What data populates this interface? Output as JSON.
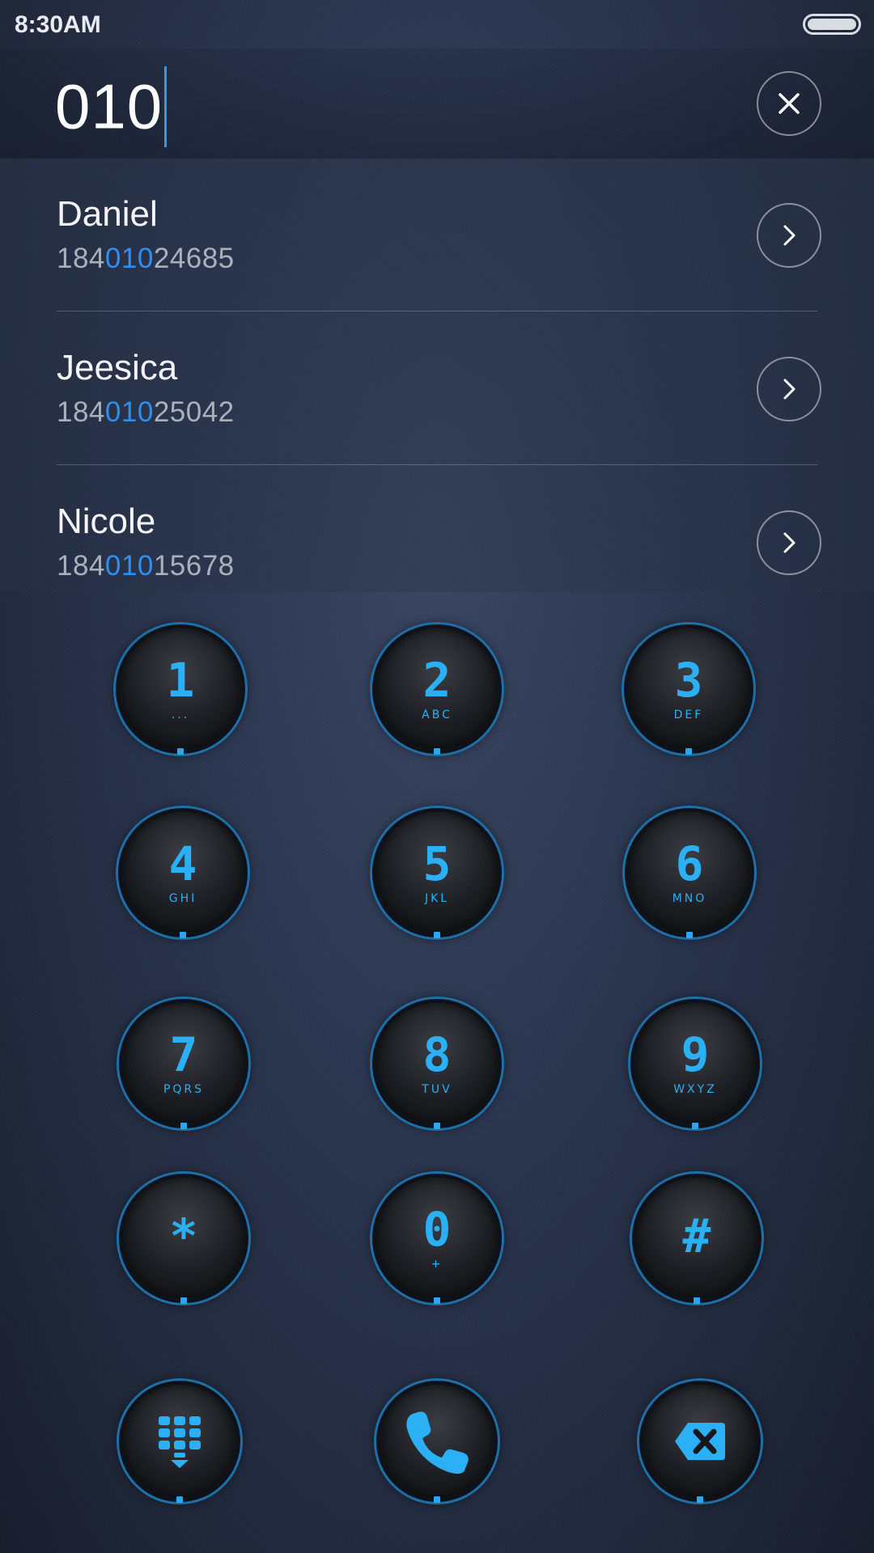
{
  "status_bar": {
    "time": "8:30AM"
  },
  "dialer": {
    "input_value": "010"
  },
  "contacts": [
    {
      "name": "Daniel",
      "number_prefix": "184",
      "number_match": "010",
      "number_suffix": "24685"
    },
    {
      "name": "Jeesica",
      "number_prefix": "184",
      "number_match": "010",
      "number_suffix": "25042"
    },
    {
      "name": "Nicole",
      "number_prefix": "184",
      "number_match": "010",
      "number_suffix": "15678"
    }
  ],
  "keypad": {
    "keys": [
      {
        "digit": "1",
        "letters": "..."
      },
      {
        "digit": "2",
        "letters": "ABC"
      },
      {
        "digit": "3",
        "letters": "DEF"
      },
      {
        "digit": "4",
        "letters": "GHI"
      },
      {
        "digit": "5",
        "letters": "JKL"
      },
      {
        "digit": "6",
        "letters": "MNO"
      },
      {
        "digit": "7",
        "letters": "PQRS"
      },
      {
        "digit": "8",
        "letters": "TUV"
      },
      {
        "digit": "9",
        "letters": "WXYZ"
      },
      {
        "digit": "*",
        "letters": ""
      },
      {
        "digit": "0",
        "letters": "+"
      },
      {
        "digit": "#",
        "letters": ""
      }
    ]
  },
  "icons": {
    "clear": "close-icon",
    "open_contact": "chevron-right-icon",
    "hide_keypad": "keypad-hide-icon",
    "call": "phone-icon",
    "backspace": "backspace-icon"
  },
  "colors": {
    "accent": "#2bb0f5",
    "match_highlight": "#2e8ff0",
    "background": "#2b3650"
  }
}
